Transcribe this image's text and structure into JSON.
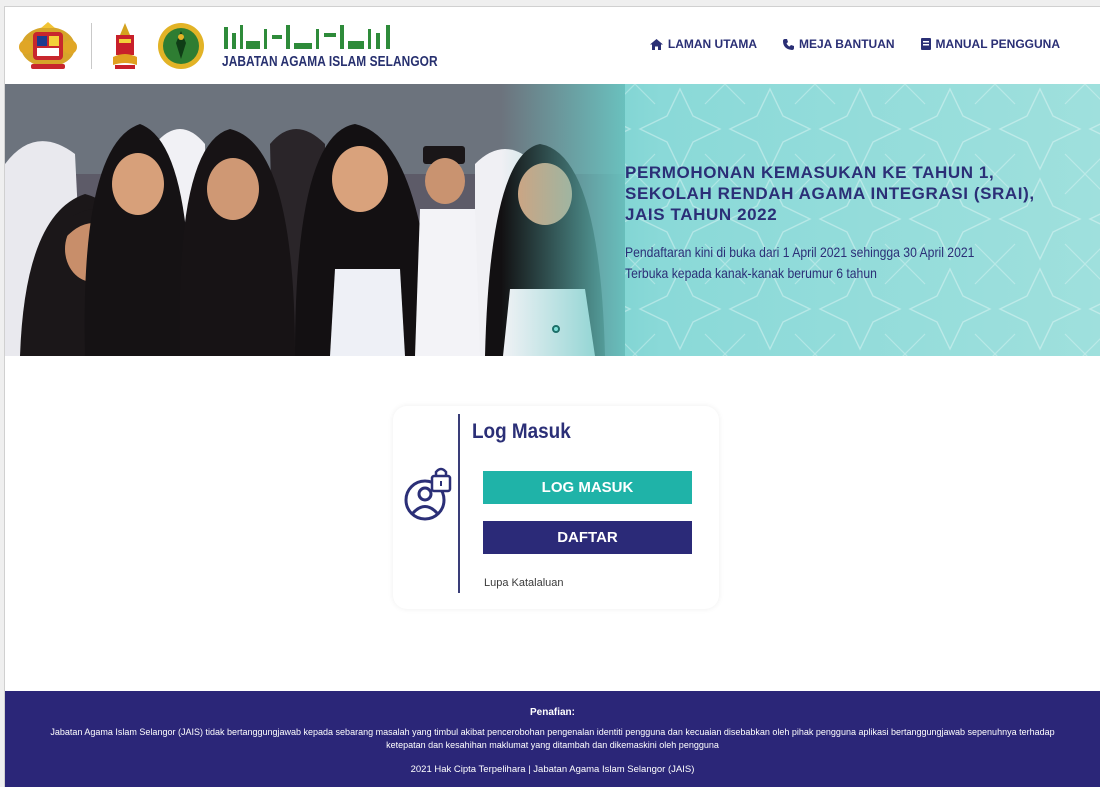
{
  "header": {
    "org_name": "JABATAN AGAMA ISLAM SELANGOR",
    "nav": [
      {
        "label": "LAMAN UTAMA",
        "icon": "home-icon"
      },
      {
        "label": "MEJA BANTUAN",
        "icon": "phone-icon"
      },
      {
        "label": "MANUAL PENGGUNA",
        "icon": "book-icon"
      }
    ]
  },
  "banner": {
    "title_lines": [
      "PERMOHONAN KEMASUKAN KE TAHUN 1,",
      "SEKOLAH RENDAH AGAMA INTEGRASI (SRAI),",
      "JAIS TAHUN 2022"
    ],
    "subtitle_1": "Pendaftaran kini di buka dari 1 April 2021 sehingga 30 April 2021",
    "subtitle_2": "Terbuka kepada kanak-kanak berumur 6 tahun"
  },
  "login": {
    "title": "Log Masuk",
    "login_button": "LOG MASUK",
    "register_button": "DAFTAR",
    "forgot_link": "Lupa Katalaluan",
    "icon": "user-lock-icon"
  },
  "footer": {
    "disclaimer_title": "Penafian:",
    "disclaimer_text": "Jabatan Agama Islam Selangor (JAIS) tidak bertanggungjawab kepada sebarang masalah yang timbul akibat pencerobohan pengenalan identiti pengguna dan kecuaian disebabkan oleh pihak pengguna aplikasi bertanggungjawab sepenuhnya terhadap ketepatan dan kesahihan maklumat yang ditambah dan dikemaskini oleh pengguna",
    "copyright": "2021 Hak Cipta Terpelihara | Jabatan Agama Islam Selangor (JAIS)"
  },
  "colors": {
    "navy": "#2b2f77",
    "teal": "#1fb3a8",
    "footer_bg": "#2b2678"
  }
}
